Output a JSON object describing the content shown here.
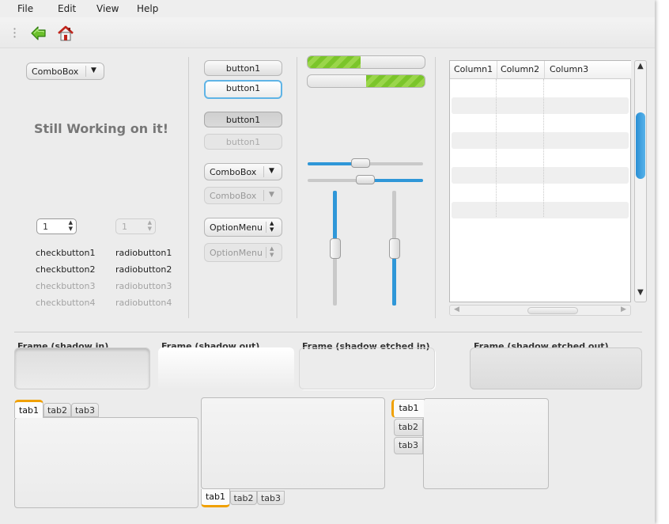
{
  "menubar": {
    "file": "File",
    "edit": "Edit",
    "view": "View",
    "help": "Help"
  },
  "toolbar": {
    "back_icon": "green-back-arrow-icon",
    "home_icon": "home-icon",
    "accent": "#3aa0e0"
  },
  "left": {
    "combo": "ComboBox",
    "wip": "Still Working on it!",
    "spin_value": "1",
    "spin_disabled_value": "1",
    "checks": [
      "checkbutton1",
      "checkbutton2",
      "checkbutton3",
      "checkbutton4"
    ],
    "radios": [
      "radiobutton1",
      "radiobutton2",
      "radiobutton3",
      "radiobutton4"
    ]
  },
  "buttons": {
    "b1": "button1",
    "b2": "button1",
    "b3": "button1",
    "b4": "button1",
    "combo1": "ComboBox",
    "combo2": "ComboBox",
    "option1": "OptionMenu",
    "option2": "OptionMenu"
  },
  "progress": {
    "bar1": 0.45,
    "bar2": 0.5
  },
  "scales": {
    "h1": 0.45,
    "h2": 0.5,
    "v1": 0.5,
    "v2": 0.5
  },
  "tree": {
    "columns": [
      "Column1",
      "Column2",
      "Column3"
    ]
  },
  "frames": {
    "in": "Frame (shadow in)",
    "out": "Frame (shadow out)",
    "etched_in": "Frame (shadow etched in)",
    "etched_out": "Frame (shadow etched out)"
  },
  "notebooks": {
    "tabs": [
      "tab1",
      "tab2",
      "tab3"
    ],
    "active_color": "#f0a000"
  }
}
